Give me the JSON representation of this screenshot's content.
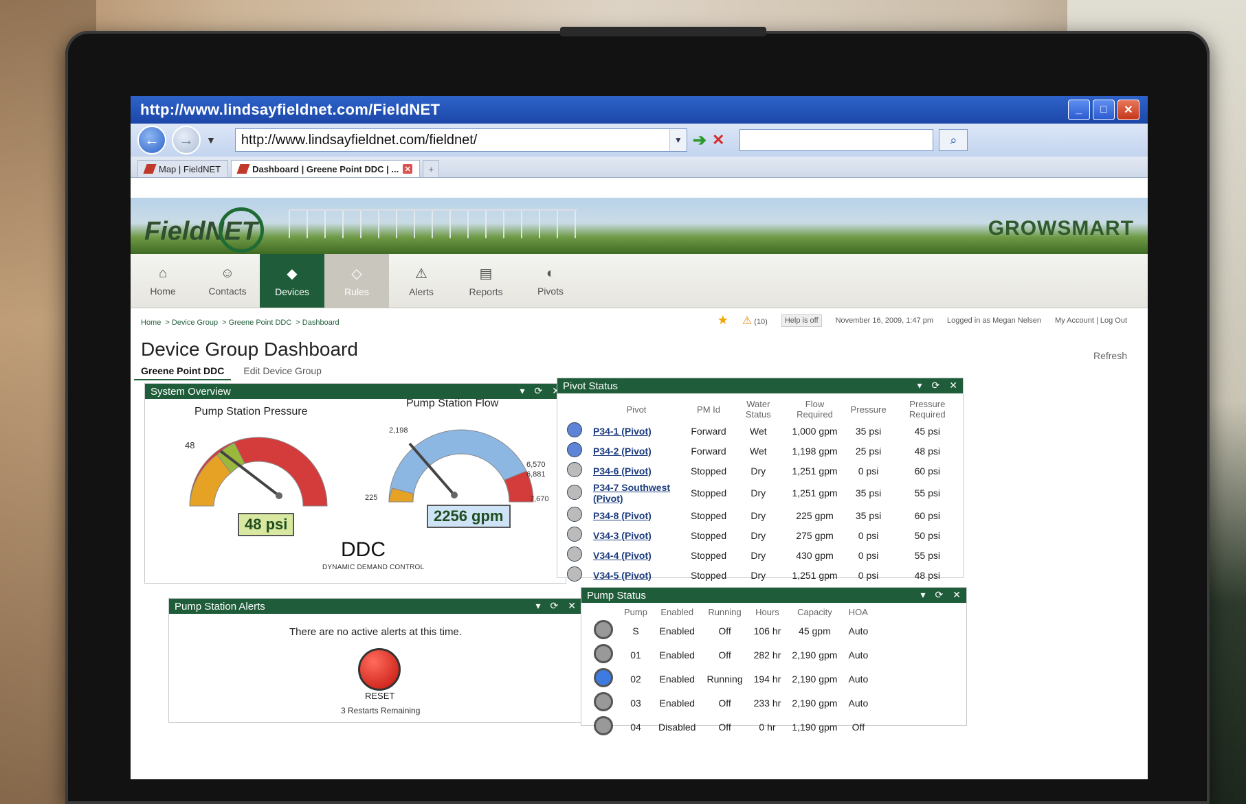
{
  "browser": {
    "title_url": "http://www.lindsayfieldnet.com/FieldNET",
    "address": "http://www.lindsayfieldnet.com/fieldnet/",
    "tabs": [
      {
        "label": "Map | FieldNET"
      },
      {
        "label": "Dashboard | Greene Point DDC | ..."
      }
    ]
  },
  "app": {
    "brand": "FieldNET",
    "partner": "GROWSMART",
    "nav": [
      {
        "label": "Home",
        "icon": "home-icon"
      },
      {
        "label": "Contacts",
        "icon": "contacts-icon"
      },
      {
        "label": "Devices",
        "icon": "devices-icon"
      },
      {
        "label": "Rules",
        "icon": "rules-icon"
      },
      {
        "label": "Alerts",
        "icon": "alerts-icon"
      },
      {
        "label": "Reports",
        "icon": "reports-icon"
      },
      {
        "label": "Pivots",
        "icon": "pivots-icon"
      }
    ],
    "breadcrumb": [
      "Home",
      "Device Group",
      "Greene Point DDC",
      "Dashboard"
    ],
    "alerts_count": "(10)",
    "help": "Help is off",
    "timestamp": "November 16, 2009, 1:47 pm",
    "logged_in": "Logged in as Megan Nelsen",
    "account": "My Account | Log Out",
    "page_title": "Device Group Dashboard",
    "refresh": "Refresh",
    "subtabs": [
      "Greene Point DDC",
      "Edit Device Group"
    ]
  },
  "overview": {
    "title": "System Overview",
    "pressure": {
      "title": "Pump Station Pressure",
      "min_label": "48",
      "value": "48 psi"
    },
    "flow": {
      "title": "Pump Station Flow",
      "labels": [
        "2,198",
        "225",
        "6,570",
        "6,881",
        "7,670"
      ],
      "value": "2256 gpm"
    },
    "ddc": "DDC",
    "ddc_sub": "DYNAMIC DEMAND CONTROL"
  },
  "alerts_panel": {
    "title": "Pump Station Alerts",
    "message": "There are no active alerts at this time.",
    "reset": "RESET",
    "restarts": "3 Restarts Remaining"
  },
  "pivot_status": {
    "title": "Pivot Status",
    "columns": [
      "Pivot",
      "PM Id",
      "Water Status",
      "Flow Required",
      "Pressure",
      "Pressure Required"
    ],
    "rows": [
      {
        "pivot": "P34-1 (Pivot)",
        "pm": "Forward",
        "water": "Wet",
        "flow": "1,000 gpm",
        "pressure": "35 psi",
        "req": "45 psi"
      },
      {
        "pivot": "P34-2 (Pivot)",
        "pm": "Forward",
        "water": "Wet",
        "flow": "1,198 gpm",
        "pressure": "25 psi",
        "req": "48 psi"
      },
      {
        "pivot": "P34-6 (Pivot)",
        "pm": "Stopped",
        "water": "Dry",
        "flow": "1,251 gpm",
        "pressure": "0 psi",
        "req": "60 psi"
      },
      {
        "pivot": "P34-7 Southwest (Pivot)",
        "pm": "Stopped",
        "water": "Dry",
        "flow": "1,251 gpm",
        "pressure": "35 psi",
        "req": "55 psi"
      },
      {
        "pivot": "P34-8 (Pivot)",
        "pm": "Stopped",
        "water": "Dry",
        "flow": "225 gpm",
        "pressure": "35 psi",
        "req": "60 psi"
      },
      {
        "pivot": "V34-3 (Pivot)",
        "pm": "Stopped",
        "water": "Dry",
        "flow": "275 gpm",
        "pressure": "0 psi",
        "req": "50 psi"
      },
      {
        "pivot": "V34-4 (Pivot)",
        "pm": "Stopped",
        "water": "Dry",
        "flow": "430 gpm",
        "pressure": "0 psi",
        "req": "55 psi"
      },
      {
        "pivot": "V34-5 (Pivot)",
        "pm": "Stopped",
        "water": "Dry",
        "flow": "1,251 gpm",
        "pressure": "0 psi",
        "req": "48 psi"
      }
    ]
  },
  "pump_status": {
    "title": "Pump Status",
    "columns": [
      "Pump",
      "Enabled",
      "Running",
      "Hours",
      "Capacity",
      "HOA"
    ],
    "rows": [
      {
        "pump": "S",
        "enabled": "Enabled",
        "running": "Off",
        "hours": "106 hr",
        "capacity": "45 gpm",
        "hoa": "Auto"
      },
      {
        "pump": "01",
        "enabled": "Enabled",
        "running": "Off",
        "hours": "282 hr",
        "capacity": "2,190 gpm",
        "hoa": "Auto"
      },
      {
        "pump": "02",
        "enabled": "Enabled",
        "running": "Running",
        "hours": "194 hr",
        "capacity": "2,190 gpm",
        "hoa": "Auto"
      },
      {
        "pump": "03",
        "enabled": "Enabled",
        "running": "Off",
        "hours": "233 hr",
        "capacity": "2,190 gpm",
        "hoa": "Auto"
      },
      {
        "pump": "04",
        "enabled": "Disabled",
        "running": "Off",
        "hours": "0 hr",
        "capacity": "1,190 gpm",
        "hoa": "Off"
      }
    ]
  }
}
